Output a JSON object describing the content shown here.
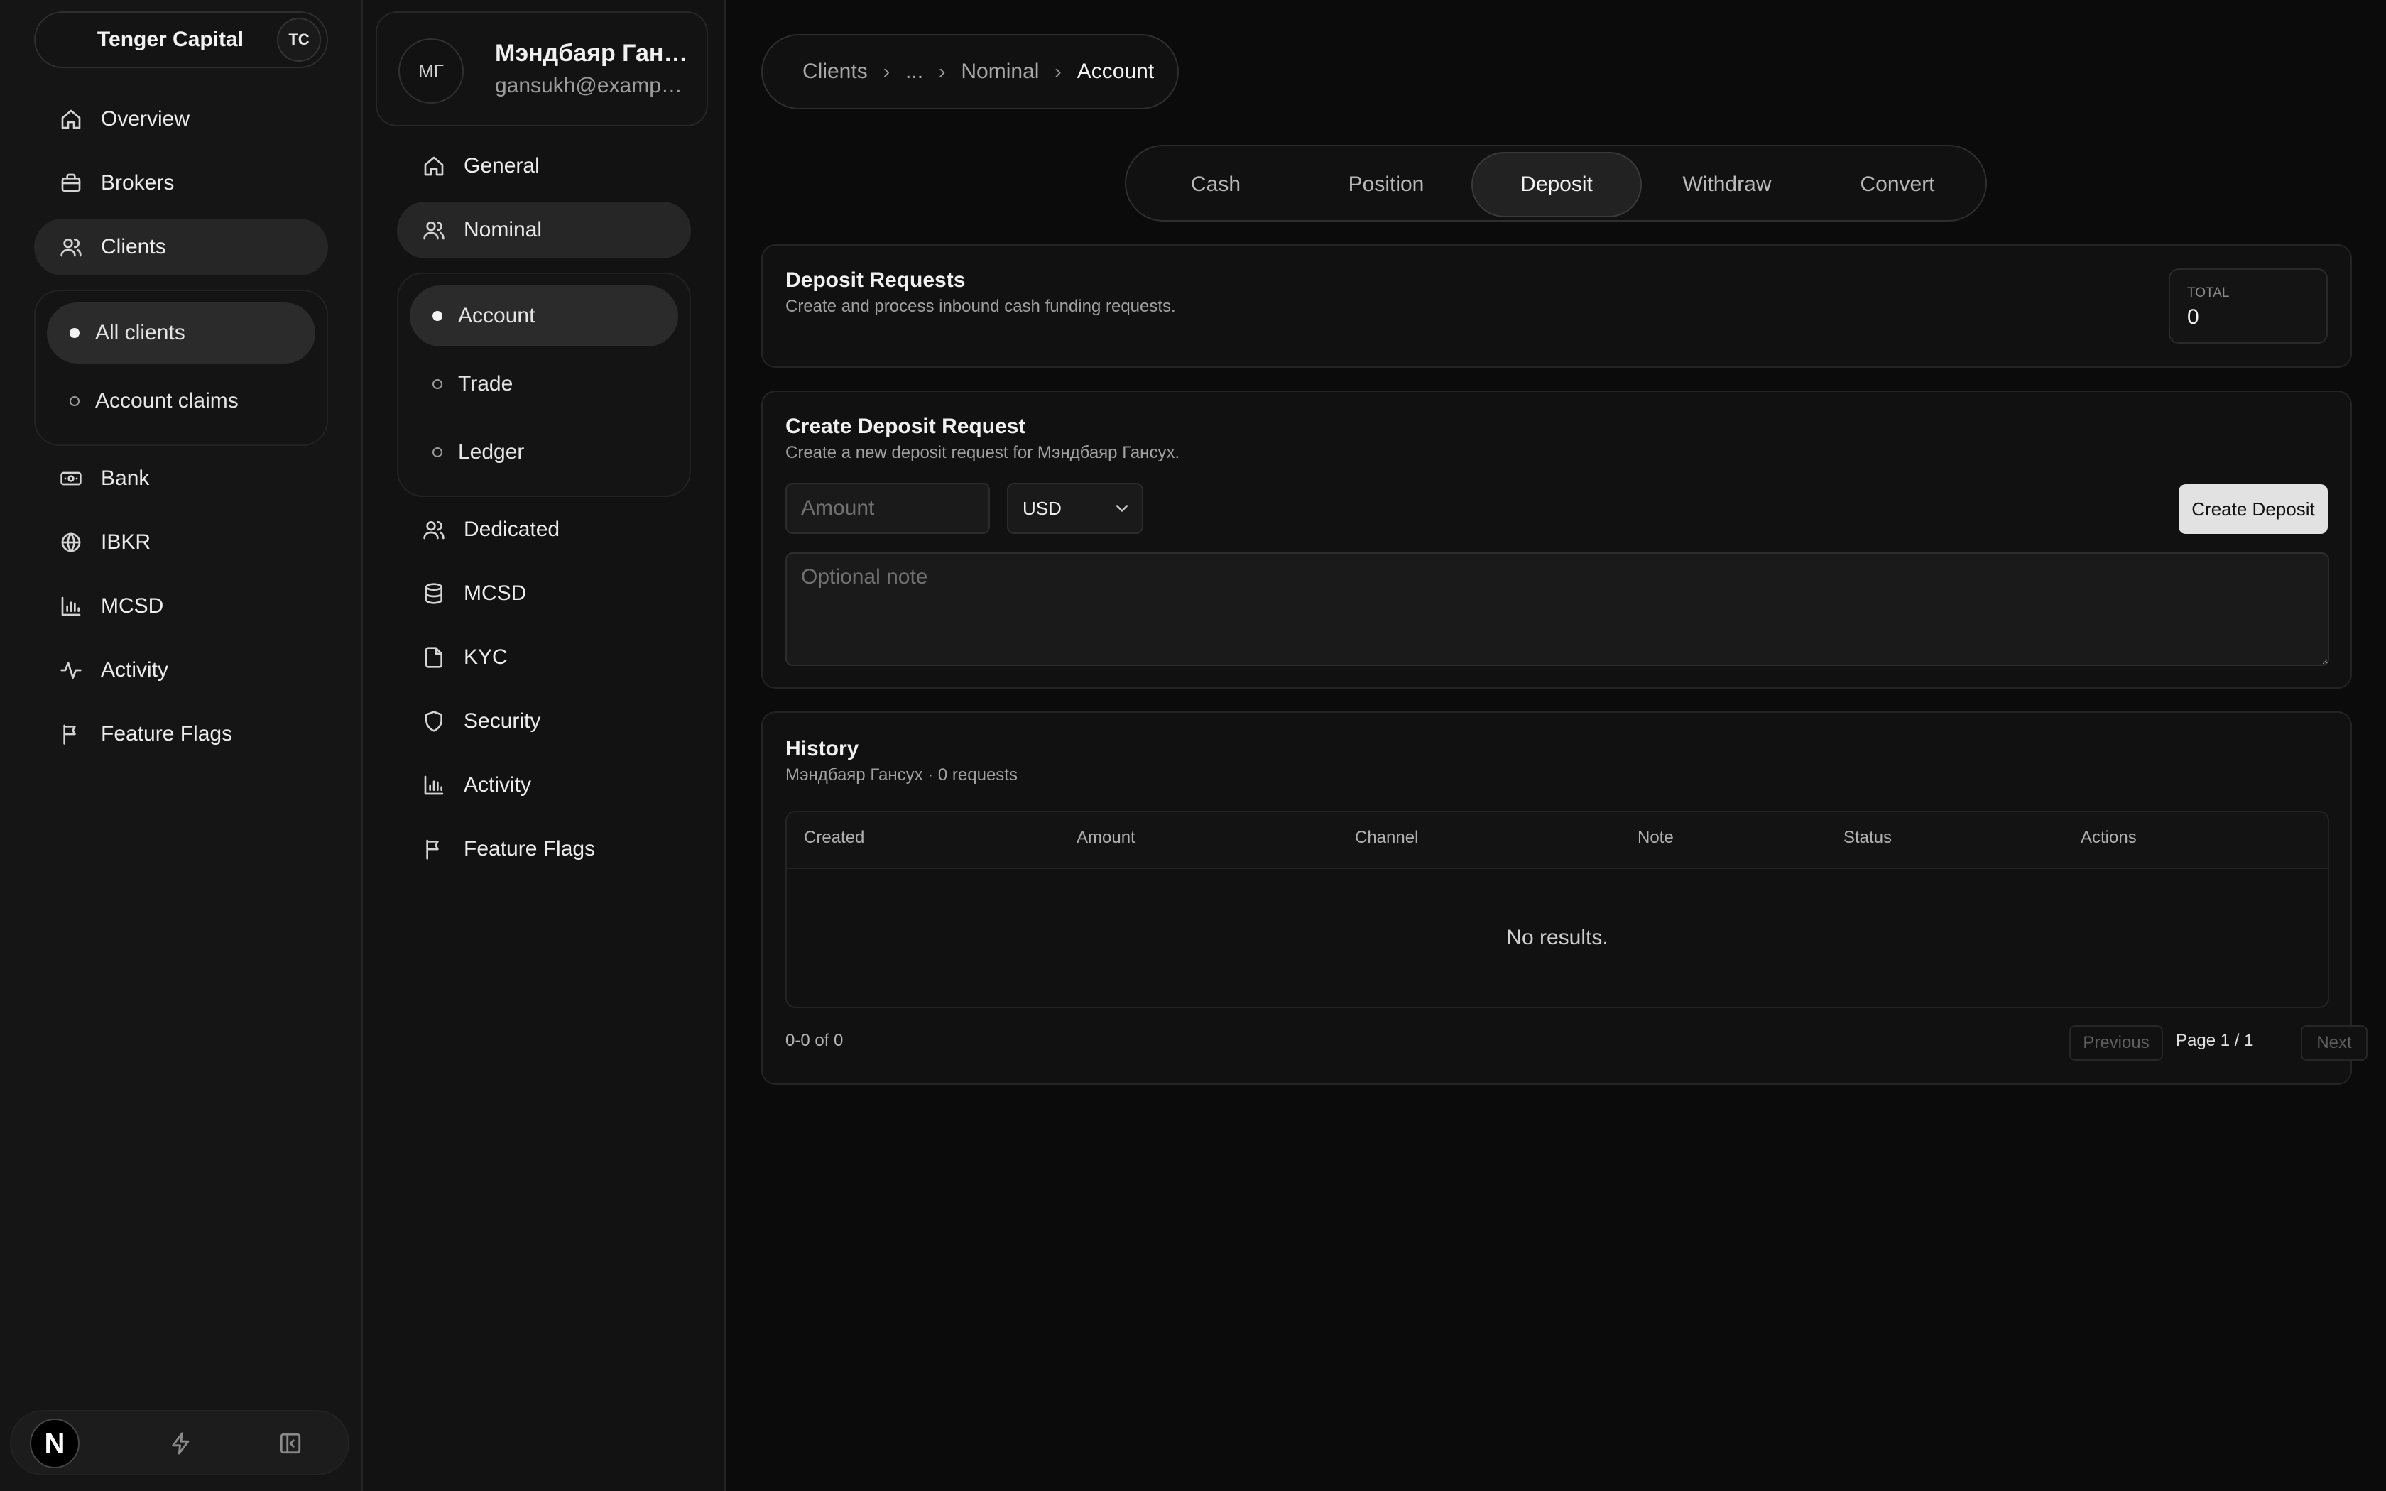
{
  "sidebar": {
    "org_name": "Tenger Capital",
    "org_badge": "TC",
    "items": [
      {
        "label": "Overview",
        "icon": "home-icon"
      },
      {
        "label": "Brokers",
        "icon": "briefcase-icon"
      },
      {
        "label": "Clients",
        "icon": "users-icon"
      },
      {
        "label": "Bank",
        "icon": "banknote-icon"
      },
      {
        "label": "IBKR",
        "icon": "globe-icon"
      },
      {
        "label": "MCSD",
        "icon": "bar-chart-icon"
      },
      {
        "label": "Activity",
        "icon": "activity-icon"
      },
      {
        "label": "Feature Flags",
        "icon": "flag-icon"
      }
    ],
    "clients_sub": [
      {
        "label": "All clients"
      },
      {
        "label": "Account claims"
      }
    ],
    "footer_logo": "N"
  },
  "client": {
    "initials": "МГ",
    "name": "Мэндбаяр Гансух",
    "email": "gansukh@example.com",
    "nav": [
      {
        "label": "General",
        "icon": "home-icon"
      },
      {
        "label": "Nominal",
        "icon": "users-icon"
      },
      {
        "label": "Dedicated",
        "icon": "users-icon"
      },
      {
        "label": "MCSD",
        "icon": "database-icon"
      },
      {
        "label": "KYC",
        "icon": "file-icon"
      },
      {
        "label": "Security",
        "icon": "shield-icon"
      },
      {
        "label": "Activity",
        "icon": "bar-chart-icon"
      },
      {
        "label": "Feature Flags",
        "icon": "flag-icon"
      }
    ],
    "nominal_sub": [
      {
        "label": "Account"
      },
      {
        "label": "Trade"
      },
      {
        "label": "Ledger"
      }
    ]
  },
  "breadcrumb": [
    "Clients",
    "...",
    "Nominal",
    "Account"
  ],
  "tabs": [
    "Cash",
    "Position",
    "Deposit",
    "Withdraw",
    "Convert"
  ],
  "active_tab": "Deposit",
  "summary": {
    "title": "Deposit Requests",
    "description": "Create and process inbound cash funding requests.",
    "total_label": "TOTAL",
    "total_value": "0"
  },
  "create": {
    "title": "Create Deposit Request",
    "description": "Create a new deposit request for Мэндбаяр Гансух.",
    "amount_placeholder": "Amount",
    "currency": "USD",
    "note_placeholder": "Optional note",
    "button": "Create Deposit"
  },
  "history": {
    "title": "History",
    "subtitle": "Мэндбаяр Гансух · 0 requests",
    "columns": [
      "Created",
      "Amount",
      "Channel",
      "Note",
      "Status",
      "Actions"
    ],
    "empty": "No results.",
    "range": "0-0 of 0",
    "prev": "Previous",
    "page": "Page 1 / 1",
    "next": "Next"
  }
}
